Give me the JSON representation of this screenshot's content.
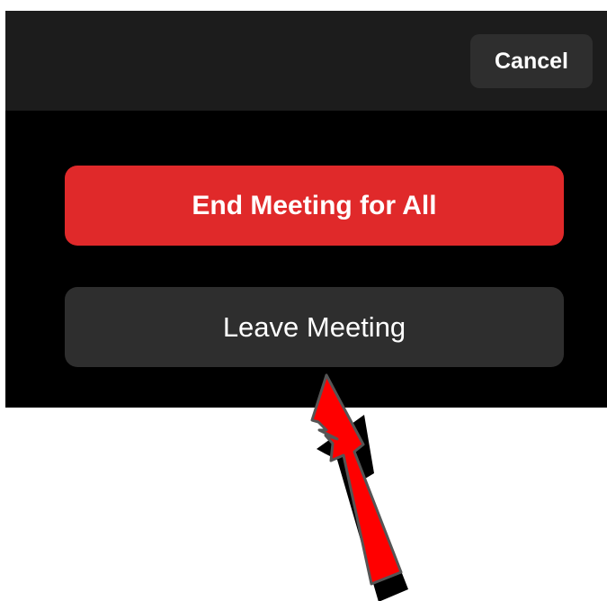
{
  "header": {
    "cancel_label": "Cancel"
  },
  "actions": {
    "end_all_label": "End Meeting for All",
    "leave_label": "Leave Meeting"
  },
  "colors": {
    "end_all_bg": "#e0292a",
    "leave_bg": "#2e2e2e",
    "cancel_bg": "#2e2e2e",
    "top_bar_bg": "#1c1c1c",
    "panel_bg": "#000000",
    "annotation_arrow": "#ff0000"
  },
  "annotation": {
    "icon": "pointer-arrow-icon"
  }
}
